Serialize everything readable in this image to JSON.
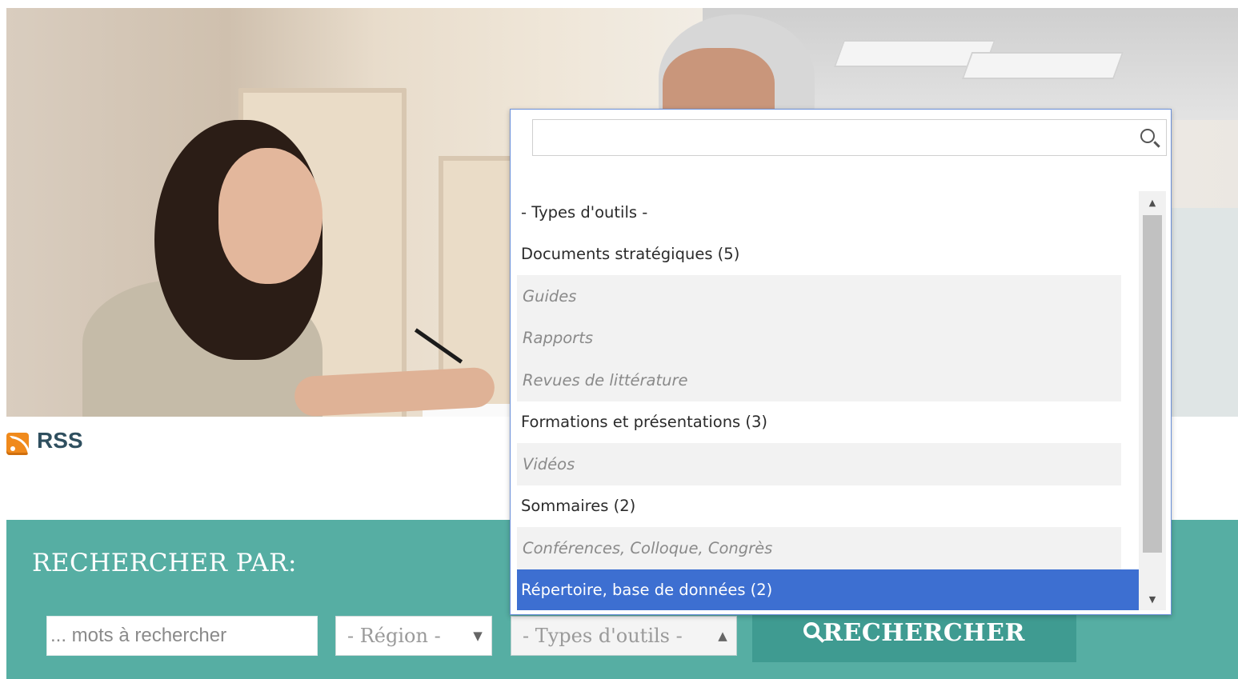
{
  "rss": {
    "label": "RSS",
    "icon": "rss-feed-icon"
  },
  "search": {
    "title": "RECHERCHER PAR:",
    "keywords_placeholder": "... mots à rechercher",
    "region_select_value": "- Région -",
    "types_select_value": "- Types d'outils -",
    "button_label": "RECHERCHER",
    "button_icon": "search-icon"
  },
  "dropdown": {
    "search_value": "",
    "items": [
      {
        "label": "- Types d'outils -",
        "level": "top"
      },
      {
        "label": "Documents stratégiques (5)",
        "level": "top"
      },
      {
        "label": "Guides",
        "level": "sub"
      },
      {
        "label": "Rapports",
        "level": "sub"
      },
      {
        "label": "Revues de littérature",
        "level": "sub"
      },
      {
        "label": "Formations et présentations (3)",
        "level": "top"
      },
      {
        "label": "Vidéos",
        "level": "sub"
      },
      {
        "label": "Sommaires (2)",
        "level": "top"
      },
      {
        "label": "Conférences, Colloque, Congrès",
        "level": "sub"
      },
      {
        "label": "Répertoire, base de données (2)",
        "level": "top",
        "selected": true
      }
    ]
  },
  "colors": {
    "search_band": "#56aea3",
    "search_button": "#3f9b91",
    "selected_item": "#3d6fd1",
    "rss_orange": "#f08a1c",
    "rss_text": "#2f4f5f"
  }
}
